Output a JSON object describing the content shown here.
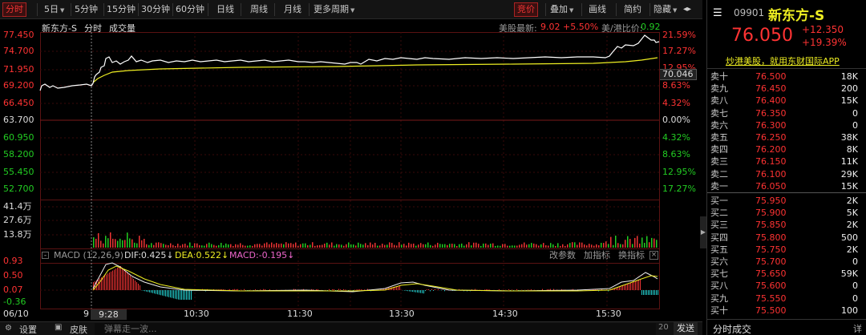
{
  "toolbar": {
    "periods": [
      "分时",
      "5日",
      "5分钟",
      "15分钟",
      "30分钟",
      "60分钟",
      "日线",
      "周线",
      "月线",
      "更多周期"
    ],
    "active": "分时",
    "right_buttons": [
      "竞价",
      "叠加",
      "画线",
      "简约",
      "隐藏"
    ],
    "right_active": "竞价",
    "menu_icon": "more-icon"
  },
  "chart": {
    "name": "新东方-S",
    "tabs": [
      "分时",
      "成交量"
    ],
    "us_latest_label": "美股最新:",
    "us_latest_price": "9.02",
    "us_latest_change": "+5.50%",
    "ratio_label": "美/港比价:",
    "ratio_value": "0.92",
    "price_left": [
      "77.450",
      "74.700",
      "71.950",
      "69.200",
      "66.450",
      "63.700",
      "60.950",
      "58.200",
      "55.450",
      "52.700"
    ],
    "price_right": [
      "21.59%",
      "17.27%",
      "12.95%",
      "8.63%",
      "4.32%",
      "0.00%",
      "4.32%",
      "8.63%",
      "12.95%",
      "17.27%"
    ],
    "avg_tag": "70.046",
    "volume_axis": [
      "41.4万",
      "27.6万",
      "13.8万"
    ],
    "macd_label": "MACD (12,26,9)",
    "dif": "DIF:0.425↓",
    "dea": "DEA:0.522↓",
    "macd": "MACD:-0.195↓",
    "macd_buttons": [
      "改参数",
      "加指标",
      "换指标"
    ],
    "macd_axis": [
      "0.93",
      "0.50",
      "0.07",
      "-0.36"
    ],
    "time_axis": [
      "06/10",
      "9",
      "9:28",
      "10:30",
      "11:30",
      "13:30",
      "14:30",
      "15:30"
    ],
    "bottom": {
      "settings": "设置",
      "skin": "皮肤",
      "danmaku_placeholder": "弹幕走一波...",
      "count": "20",
      "send": "发送"
    }
  },
  "colors": {
    "up": "#ff3333",
    "down": "#22cc22",
    "price_line": "#ffffff",
    "avg_line": "#eeee22",
    "accent": "#dd2222"
  },
  "quote": {
    "code": "09901",
    "name": "新东方-S",
    "price": "76.050",
    "change": "+12.350",
    "change_pct": "+19.39%",
    "promo": "炒港美股，就用东财国际APP",
    "asks": [
      {
        "label": "卖十",
        "price": "76.500",
        "vol": "18K"
      },
      {
        "label": "卖九",
        "price": "76.450",
        "vol": "200"
      },
      {
        "label": "卖八",
        "price": "76.400",
        "vol": "15K"
      },
      {
        "label": "卖七",
        "price": "76.350",
        "vol": "0"
      },
      {
        "label": "卖六",
        "price": "76.300",
        "vol": "0"
      },
      {
        "label": "卖五",
        "price": "76.250",
        "vol": "38K"
      },
      {
        "label": "卖四",
        "price": "76.200",
        "vol": "8K"
      },
      {
        "label": "卖三",
        "price": "76.150",
        "vol": "11K"
      },
      {
        "label": "卖二",
        "price": "76.100",
        "vol": "29K"
      },
      {
        "label": "卖一",
        "price": "76.050",
        "vol": "15K"
      }
    ],
    "bids": [
      {
        "label": "买一",
        "price": "75.950",
        "vol": "2K"
      },
      {
        "label": "买二",
        "price": "75.900",
        "vol": "5K"
      },
      {
        "label": "买三",
        "price": "75.850",
        "vol": "2K"
      },
      {
        "label": "买四",
        "price": "75.800",
        "vol": "500"
      },
      {
        "label": "买五",
        "price": "75.750",
        "vol": "2K"
      },
      {
        "label": "买六",
        "price": "75.700",
        "vol": "0"
      },
      {
        "label": "买七",
        "price": "75.650",
        "vol": "59K"
      },
      {
        "label": "买八",
        "price": "75.600",
        "vol": "0"
      },
      {
        "label": "买九",
        "price": "75.550",
        "vol": "0"
      },
      {
        "label": "买十",
        "price": "75.500",
        "vol": "100"
      }
    ],
    "footer": "分时成交",
    "footer_detail": "详"
  }
}
